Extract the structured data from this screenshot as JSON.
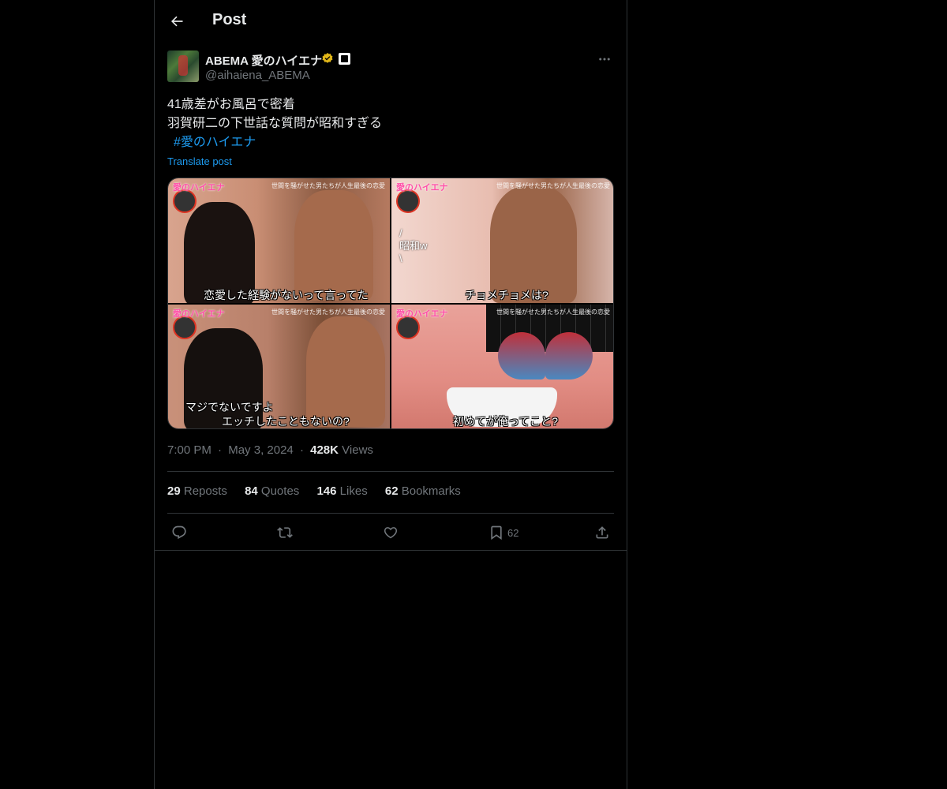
{
  "header": {
    "title": "Post"
  },
  "author": {
    "display_name": "ABEMA 愛のハイエナ",
    "handle": "@aihaiena_ABEMA",
    "verified_color": "#e2b719"
  },
  "post": {
    "lines": [
      "41歳差がお風呂で密着",
      "羽賀研二の下世話な質問が昭和すぎる"
    ],
    "hashtag": "#愛のハイエナ",
    "translate_label": "Translate post"
  },
  "media": {
    "logo": "愛のハイエナ",
    "top_caption": "世間を騒がせた男たちが人生最後の恋愛",
    "tiles": [
      {
        "caption": "恋愛した経験がないって言ってた"
      },
      {
        "caption": "チョメチョメは?",
        "side_text": [
          "/",
          "昭和w",
          "\\"
        ]
      },
      {
        "caption_1": "マジでないですよ",
        "caption_2": "エッチしたこともないの?"
      },
      {
        "caption": "初めてが俺ってこと?"
      }
    ]
  },
  "meta": {
    "time": "7:00 PM",
    "sep": "·",
    "date": "May 3, 2024",
    "views_count": "428K",
    "views_label": "Views"
  },
  "stats": {
    "reposts_count": "29",
    "reposts_label": "Reposts",
    "quotes_count": "84",
    "quotes_label": "Quotes",
    "likes_count": "146",
    "likes_label": "Likes",
    "bookmarks_count": "62",
    "bookmarks_label": "Bookmarks"
  },
  "actions": {
    "bookmark_count": "62"
  },
  "colors": {
    "accent": "#1d9bf0",
    "text": "#e7e9ea",
    "muted": "#71767b",
    "border": "#2f3336"
  }
}
